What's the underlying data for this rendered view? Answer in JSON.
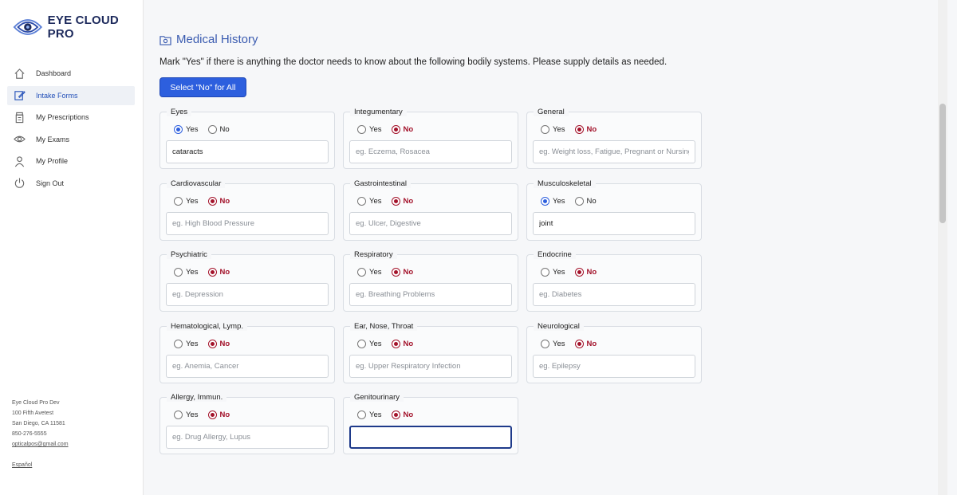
{
  "brand": {
    "name": "EYE CLOUD PRO"
  },
  "sidebar": {
    "items": [
      {
        "label": "Dashboard",
        "icon": "home-icon",
        "active": false
      },
      {
        "label": "Intake Forms",
        "icon": "edit-icon",
        "active": true
      },
      {
        "label": "My Prescriptions",
        "icon": "prescription-icon",
        "active": false
      },
      {
        "label": "My Exams",
        "icon": "eye-icon",
        "active": false
      },
      {
        "label": "My Profile",
        "icon": "user-icon",
        "active": false
      },
      {
        "label": "Sign Out",
        "icon": "power-icon",
        "active": false
      }
    ],
    "footer": {
      "company": "Eye Cloud Pro Dev",
      "address1": "100 Fifth Avetest",
      "address2": "San Diego, CA 11581",
      "phone": "850-276-5555",
      "email": "opticalpos@gmail.com",
      "language": "Español"
    }
  },
  "main": {
    "title": "Medical History",
    "description": "Mark \"Yes\" if there is anything the doctor needs to know about the following bodily systems. Please supply details as needed.",
    "no_all_label": "Select \"No\" for All",
    "yes_label": "Yes",
    "no_label": "No",
    "systems": [
      {
        "label": "Eyes",
        "selected": "yes",
        "value": "cataracts",
        "placeholder": ""
      },
      {
        "label": "Integumentary",
        "selected": "no",
        "value": "",
        "placeholder": "eg. Eczema, Rosacea"
      },
      {
        "label": "General",
        "selected": "no",
        "value": "",
        "placeholder": "eg. Weight loss, Fatigue, Pregnant or Nursing"
      },
      {
        "label": "Cardiovascular",
        "selected": "no",
        "value": "",
        "placeholder": "eg. High Blood Pressure"
      },
      {
        "label": "Gastrointestinal",
        "selected": "no",
        "value": "",
        "placeholder": "eg. Ulcer, Digestive"
      },
      {
        "label": "Musculoskeletal",
        "selected": "yes",
        "value": "joint",
        "placeholder": ""
      },
      {
        "label": "Psychiatric",
        "selected": "no",
        "value": "",
        "placeholder": "eg. Depression"
      },
      {
        "label": "Respiratory",
        "selected": "no",
        "value": "",
        "placeholder": "eg. Breathing Problems"
      },
      {
        "label": "Endocrine",
        "selected": "no",
        "value": "",
        "placeholder": "eg. Diabetes"
      },
      {
        "label": "Hematological, Lymp.",
        "selected": "no",
        "value": "",
        "placeholder": "eg. Anemia, Cancer"
      },
      {
        "label": "Ear, Nose, Throat",
        "selected": "no",
        "value": "",
        "placeholder": "eg. Upper Respiratory Infection"
      },
      {
        "label": "Neurological",
        "selected": "no",
        "value": "",
        "placeholder": "eg. Epilepsy"
      },
      {
        "label": "Allergy, Immun.",
        "selected": "no",
        "value": "",
        "placeholder": "eg. Drug Allergy, Lupus"
      },
      {
        "label": "Genitourinary",
        "selected": "no",
        "value": "",
        "placeholder": "",
        "focused": true
      }
    ]
  },
  "colors": {
    "accent": "#2d5fde",
    "no_selected": "#a3122a",
    "title": "#3a5bb0"
  }
}
